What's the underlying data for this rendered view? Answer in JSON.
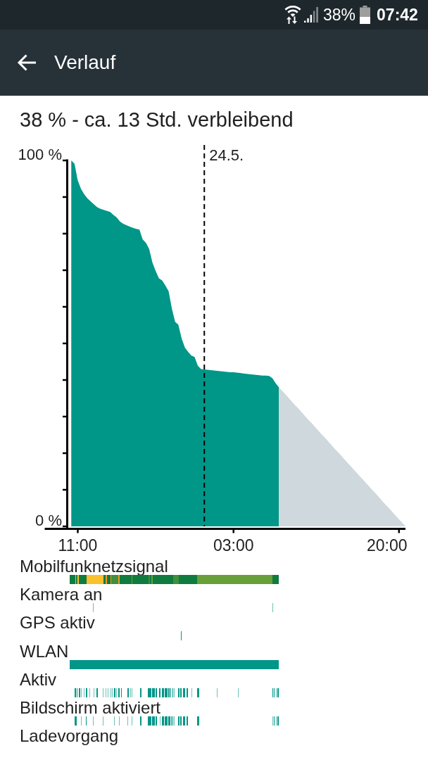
{
  "status_bar": {
    "battery_percent": "38%",
    "time": "07:42"
  },
  "app_bar": {
    "title": "Verlauf"
  },
  "summary": "38 % - ca. 13 Std. verbleibend",
  "battery_chart": {
    "chart_data": {
      "type": "area",
      "categories": [
        null,
        null,
        "11:00",
        null,
        null,
        null,
        null,
        null,
        null,
        null,
        null,
        null,
        null,
        null,
        null,
        null,
        null,
        null,
        null,
        null,
        null,
        null,
        null,
        null,
        null,
        null,
        null,
        null,
        null,
        null,
        null,
        null,
        null,
        null,
        null,
        null,
        null,
        null,
        null,
        null,
        null,
        null,
        null,
        null,
        null,
        null,
        null,
        null,
        null,
        null,
        "03:00",
        null,
        null,
        null,
        null,
        null,
        null,
        null,
        null,
        null,
        null,
        null,
        null,
        null,
        null,
        null,
        null,
        null,
        null,
        null,
        null,
        null,
        null,
        null,
        null,
        null,
        null,
        null,
        null,
        null,
        null,
        null,
        null,
        null,
        null,
        null,
        null,
        null,
        null,
        null,
        null,
        null,
        null,
        null,
        null,
        null,
        null,
        null,
        null,
        null,
        null,
        "20:00",
        null,
        null
      ],
      "series": [
        {
          "color": "#009688",
          "values": [
            100,
            99.1,
            94.5,
            92.2,
            90.7,
            89.6,
            88.8,
            88.0,
            87.2,
            86.8,
            86.5,
            86.2,
            85.9,
            85.1,
            84.4,
            83.3,
            82.7,
            82.3,
            81.9,
            81.6,
            81.3,
            81.1,
            78.4,
            77.5,
            75.8,
            72.1,
            69.8,
            67.8,
            67.2,
            65.8,
            64.3,
            59.5,
            55.9,
            55.1,
            51.4,
            48.9,
            47.7,
            46.7,
            46.3,
            43.9,
            43.0,
            42.9,
            42.8,
            42.7,
            42.6,
            42.5,
            42.4,
            42.3,
            42.2,
            42.1,
            42.1,
            42.0,
            41.9,
            41.8,
            41.7,
            41.6,
            41.5,
            41.4,
            41.3,
            41.2,
            41.2,
            41.1,
            40.5,
            39.1,
            38.0,
            null,
            null,
            null,
            null,
            null,
            null,
            null,
            null,
            null,
            null,
            null,
            null,
            null,
            null,
            null,
            null,
            null,
            null,
            null,
            null,
            null,
            null,
            null,
            null,
            null,
            null,
            null,
            null,
            null,
            null,
            null,
            null,
            null,
            null,
            null,
            null,
            null,
            null,
            null
          ]
        },
        {
          "color": "#cfd8dc",
          "values": [
            null,
            null,
            null,
            null,
            null,
            null,
            null,
            null,
            null,
            null,
            null,
            null,
            null,
            null,
            null,
            null,
            null,
            null,
            null,
            null,
            null,
            null,
            null,
            null,
            null,
            null,
            null,
            null,
            null,
            null,
            null,
            null,
            null,
            null,
            null,
            null,
            null,
            null,
            null,
            null,
            null,
            null,
            null,
            null,
            null,
            null,
            null,
            null,
            null,
            null,
            null,
            null,
            null,
            null,
            null,
            null,
            null,
            null,
            null,
            null,
            null,
            null,
            null,
            null,
            38,
            37,
            36.1,
            35.1,
            34.1,
            33.1,
            32.2,
            31.2,
            30.2,
            29.2,
            28.3,
            27.3,
            26.3,
            25.3,
            24.4,
            23.4,
            22.4,
            21.4,
            20.5,
            19.5,
            18.5,
            17.5,
            16.6,
            15.6,
            14.6,
            13.6,
            12.7,
            11.7,
            10.7,
            9.7,
            8.8,
            7.8,
            6.8,
            5.8,
            4.9,
            3.9,
            2.9,
            1.9,
            1,
            0
          ]
        }
      ],
      "ylim": [
        0,
        100
      ],
      "yticks": [
        {
          "value": 0,
          "label": "0 %"
        },
        {
          "value": 100,
          "label": "100 %"
        }
      ],
      "annotations": [
        "24.5."
      ]
    }
  },
  "usage_rows": [
    {
      "label": "Mobilfunknetzsignal",
      "kind": "signal"
    },
    {
      "label": "Kamera an",
      "kind": "camera"
    },
    {
      "label": "GPS aktiv",
      "kind": "gps"
    },
    {
      "label": "WLAN",
      "kind": "wlan"
    },
    {
      "label": "Aktiv",
      "kind": "active"
    },
    {
      "label": "Bildschirm aktiviert",
      "kind": "screen"
    },
    {
      "label": "Ladevorgang",
      "kind": "charging"
    }
  ]
}
